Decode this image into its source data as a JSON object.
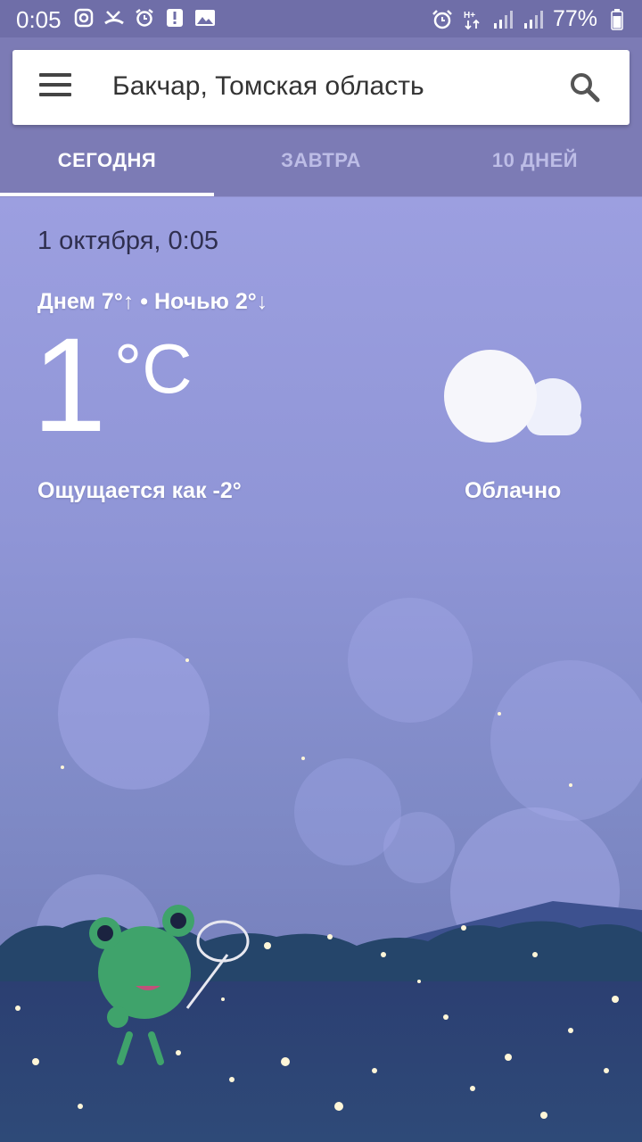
{
  "status_bar": {
    "time": "0:05",
    "battery": "77%",
    "left_icons": [
      "instagram-icon",
      "missed-call-icon",
      "alarm-icon",
      "alert-icon",
      "image-icon"
    ],
    "right_icons": [
      "alarm-icon",
      "data-transfer-icon",
      "signal-icon",
      "signal-icon",
      "battery-icon"
    ]
  },
  "search": {
    "location": "Бакчар, Томская область"
  },
  "tabs": [
    {
      "label": "СЕГОДНЯ",
      "active": true
    },
    {
      "label": "ЗАВТРА",
      "active": false
    },
    {
      "label": "10 ДНЕЙ",
      "active": false
    }
  ],
  "weather": {
    "date_time": "1 октября, 0:05",
    "day_night": "Днем 7°↑ • Ночью 2°↓",
    "temperature": "1",
    "unit": "°C",
    "feels_like": "Ощущается как -2°",
    "condition": "Облачно",
    "condition_icon": "cloudy-night-icon"
  },
  "colors": {
    "header": "#7c7bb5",
    "sky": "#9c9fe0",
    "tab_active": "#ffffff",
    "tab_inactive": "#bdbde6"
  }
}
